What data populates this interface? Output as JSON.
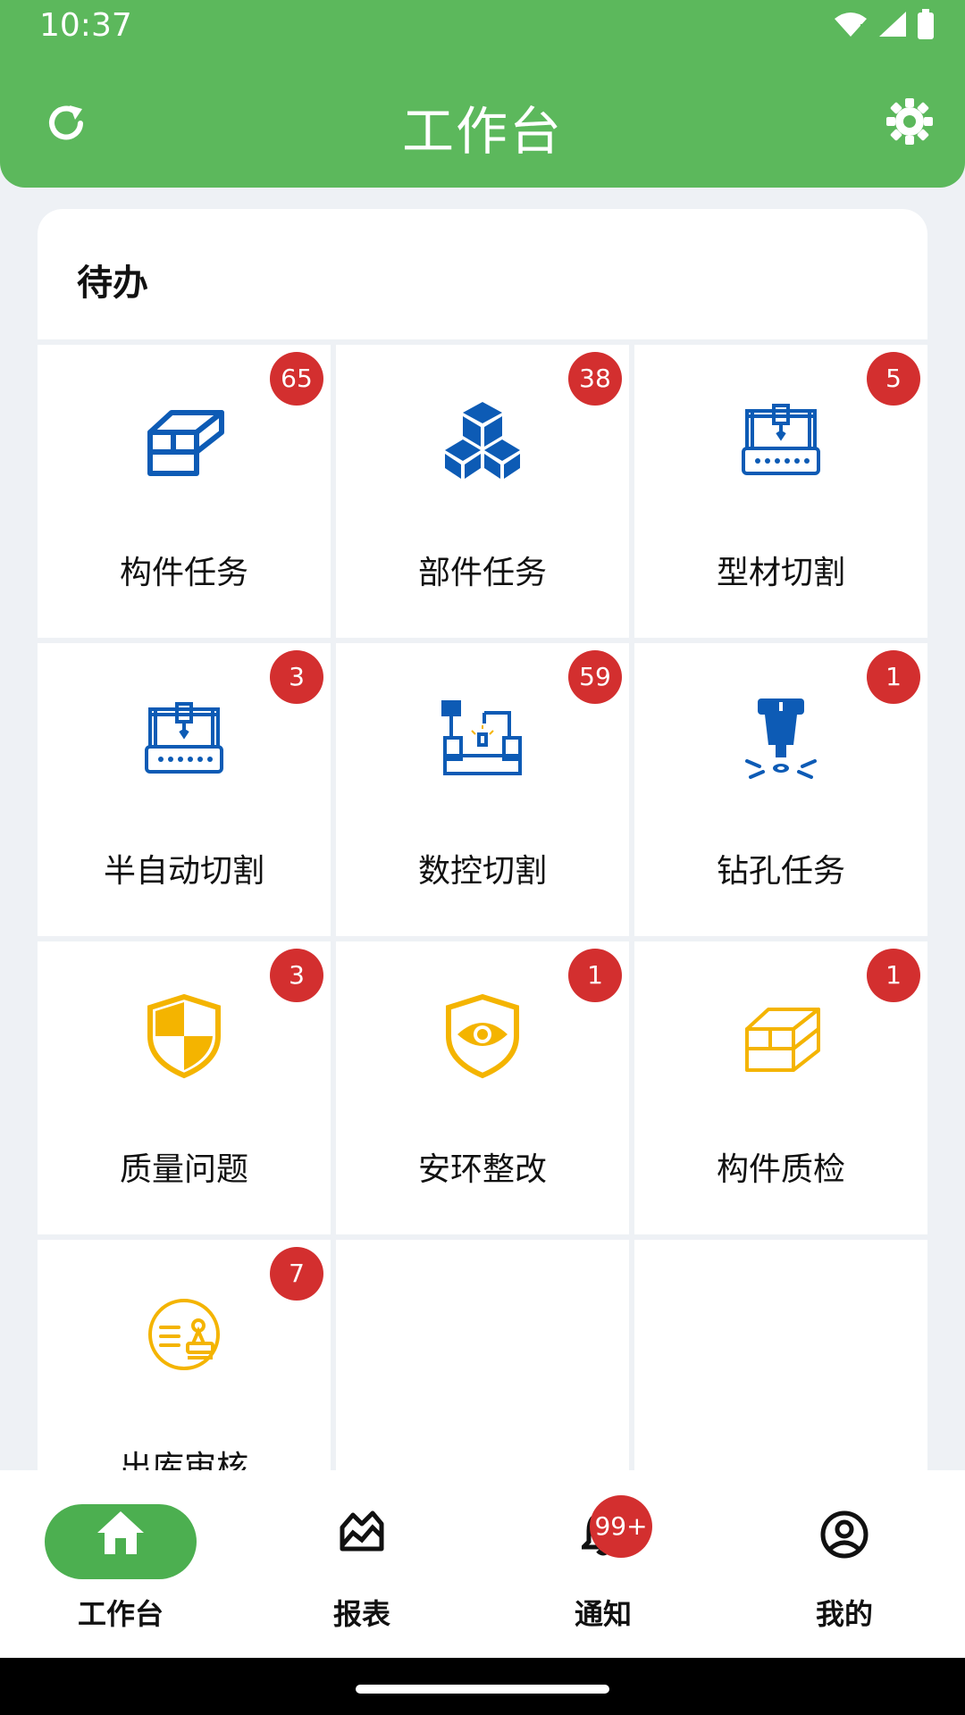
{
  "status": {
    "time": "10:37"
  },
  "header": {
    "title": "工作台"
  },
  "section": {
    "title": "待办"
  },
  "tiles": [
    {
      "label": "构件任务",
      "badge": "65",
      "icon": "steel-beam-icon",
      "color": "#0d5bb5"
    },
    {
      "label": "部件任务",
      "badge": "38",
      "icon": "cubes-icon",
      "color": "#0d5bb5"
    },
    {
      "label": "型材切割",
      "badge": "5",
      "icon": "cutting-machine-icon",
      "color": "#0d5bb5"
    },
    {
      "label": "半自动切割",
      "badge": "3",
      "icon": "semi-auto-cutter-icon",
      "color": "#0d5bb5"
    },
    {
      "label": "数控切割",
      "badge": "59",
      "icon": "cnc-cutter-icon",
      "color": "#0d5bb5"
    },
    {
      "label": "钻孔任务",
      "badge": "1",
      "icon": "drill-icon",
      "color": "#0d5bb5"
    },
    {
      "label": "质量问题",
      "badge": "3",
      "icon": "quality-shield-icon",
      "color": "#f4b400"
    },
    {
      "label": "安环整改",
      "badge": "1",
      "icon": "eye-shield-icon",
      "color": "#f4b400"
    },
    {
      "label": "构件质检",
      "badge": "1",
      "icon": "steel-beam-outline-icon",
      "color": "#f4b400"
    },
    {
      "label": "出库审核",
      "badge": "7",
      "icon": "approval-stamp-icon",
      "color": "#f4b400"
    }
  ],
  "nav": {
    "items": [
      {
        "label": "工作台"
      },
      {
        "label": "报表"
      },
      {
        "label": "通知",
        "badge": "99+"
      },
      {
        "label": "我的"
      }
    ]
  },
  "colors": {
    "primary": "#5cb85c",
    "badge": "#d32f2f",
    "blue": "#0d5bb5",
    "yellow": "#f4b400"
  }
}
